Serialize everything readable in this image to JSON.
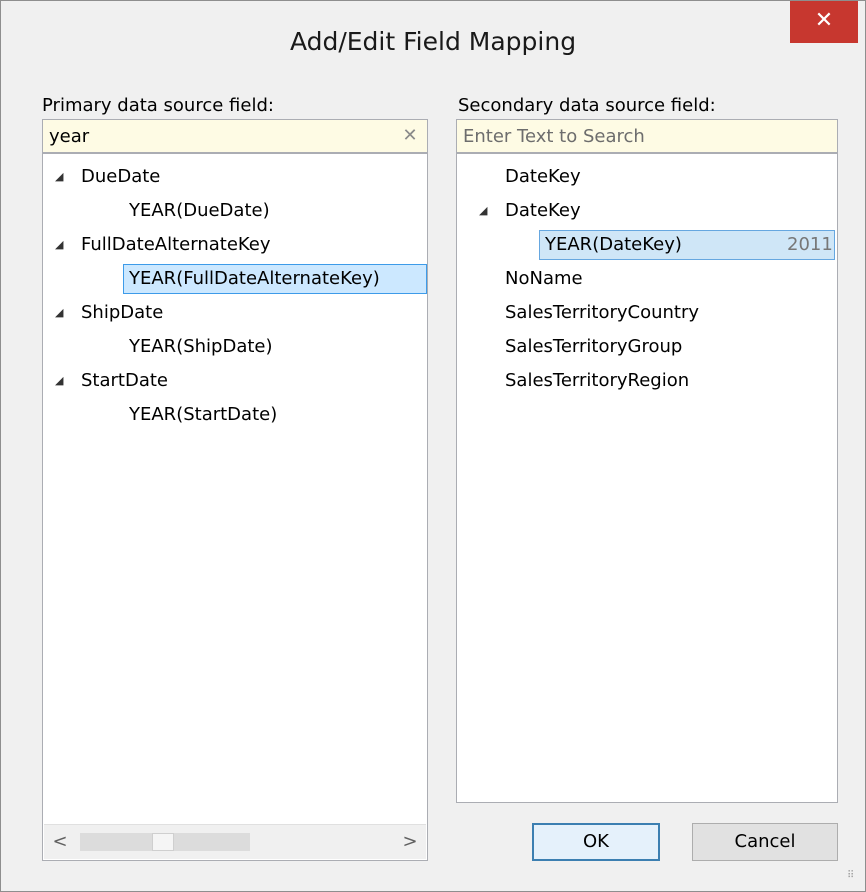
{
  "window": {
    "title": "Add/Edit Field Mapping",
    "close_glyph": "✕"
  },
  "primary": {
    "label": "Primary data source field:",
    "search_value": "year",
    "clear_glyph": "✕",
    "items": [
      {
        "label": "DueDate",
        "expanded": true,
        "children": [
          "YEAR(DueDate)"
        ]
      },
      {
        "label": "FullDateAlternateKey",
        "expanded": true,
        "children": [
          "YEAR(FullDateAlternateKey)"
        ]
      },
      {
        "label": "ShipDate",
        "expanded": true,
        "children": [
          "YEAR(ShipDate)"
        ]
      },
      {
        "label": "StartDate",
        "expanded": true,
        "children": [
          "YEAR(StartDate)"
        ]
      }
    ],
    "selected": "YEAR(FullDateAlternateKey)",
    "scroll_left_glyph": "<",
    "scroll_right_glyph": ">"
  },
  "secondary": {
    "label": "Secondary data source field:",
    "search_placeholder": "Enter Text to Search",
    "items": [
      {
        "label": "DateKey"
      },
      {
        "label": "DateKey",
        "expanded": true,
        "children": [
          {
            "label": "YEAR(DateKey)",
            "badge": "2011"
          }
        ]
      },
      {
        "label": "NoName"
      },
      {
        "label": "SalesTerritoryCountry"
      },
      {
        "label": "SalesTerritoryGroup"
      },
      {
        "label": "SalesTerritoryRegion"
      }
    ]
  },
  "buttons": {
    "ok": "OK",
    "cancel": "Cancel"
  },
  "icons": {
    "expander": "◢",
    "close": "close-icon",
    "clear": "clear-icon"
  },
  "colors": {
    "close_bg": "#c7372f",
    "selection_bg": "#cce8ff",
    "selection_border": "#3d9be9",
    "search_bg": "#fefbe4"
  }
}
